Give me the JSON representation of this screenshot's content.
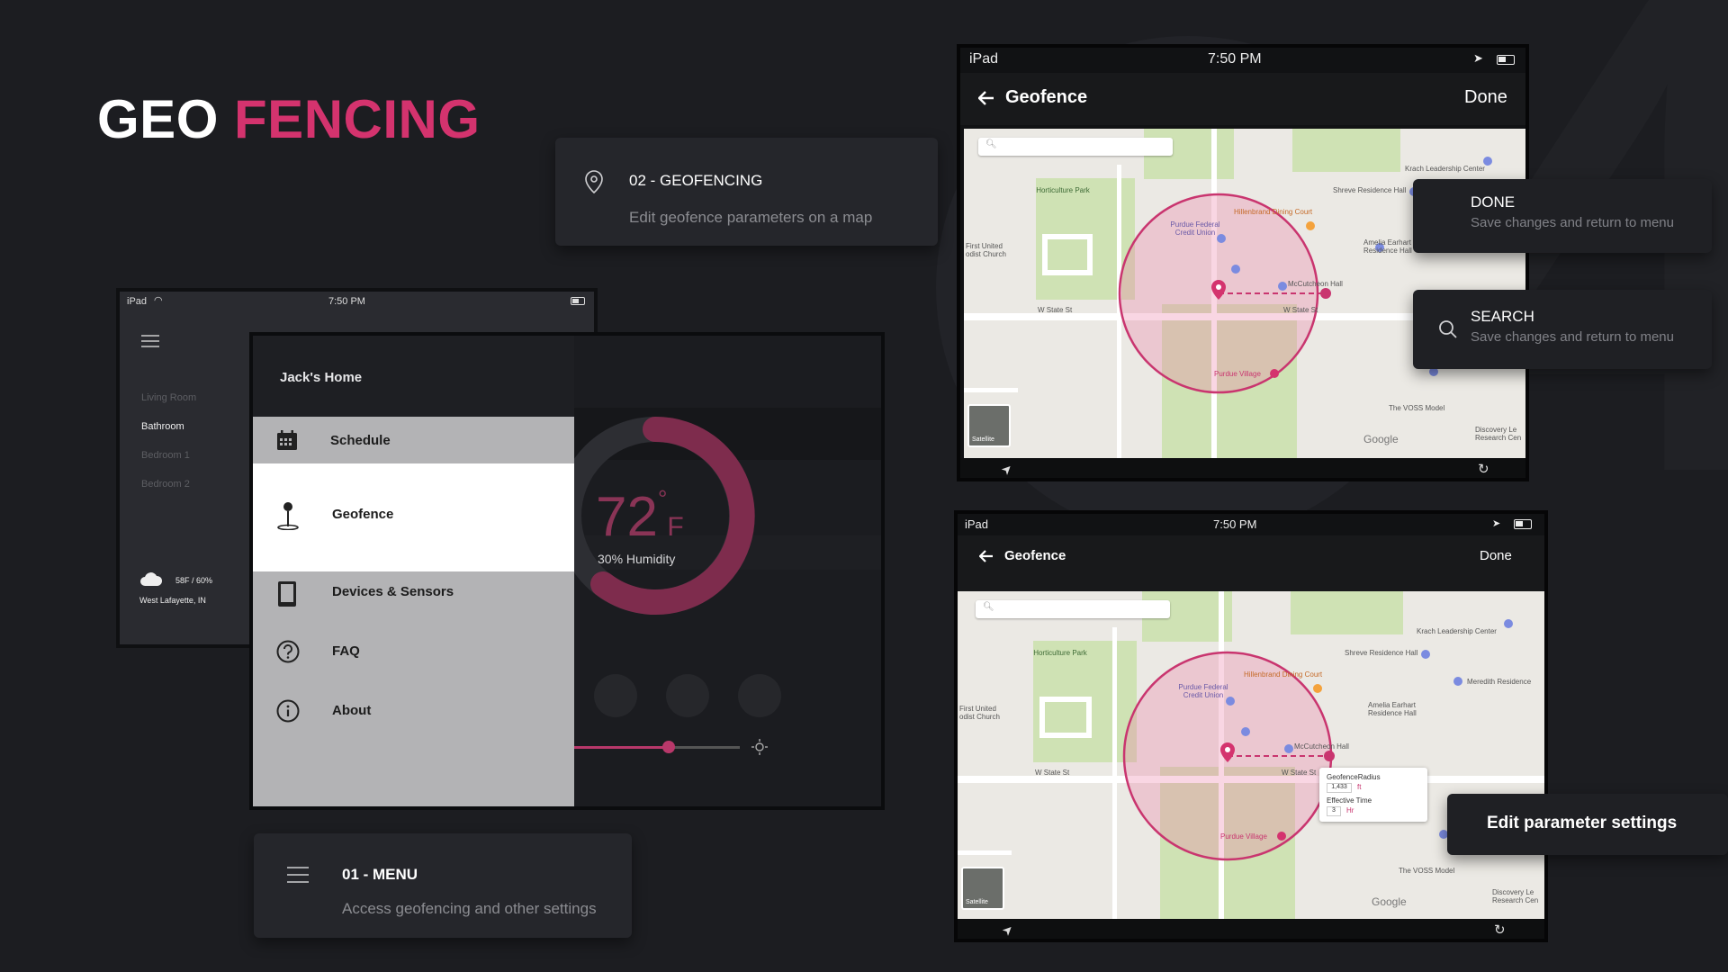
{
  "title": {
    "part1": "GEO",
    "part2": "FENCING"
  },
  "accent": "#d4336e",
  "card_geofencing": {
    "head": "02 - GEOFENCING",
    "sub": "Edit geofence parameters on a map",
    "icon": "map-pin-icon"
  },
  "card_menu": {
    "head": "01 - MENU",
    "sub": "Access geofencing and other settings",
    "icon": "hamburger-icon"
  },
  "card_done": {
    "head": "DONE",
    "sub": "Save changes and return to menu"
  },
  "card_search": {
    "head": "SEARCH",
    "sub": "Save changes and return to menu",
    "icon": "search-icon"
  },
  "card_edit": {
    "label": "Edit parameter settings"
  },
  "left_tablet": {
    "status": {
      "device": "iPad",
      "time": "7:50 PM"
    },
    "rooms": [
      "Living Room",
      "Bathroom",
      "Bedroom 1",
      "Bedroom 2"
    ],
    "weather": {
      "temp": "58F / 60%",
      "location": "West Lafayette, IN"
    },
    "home_name": "Jack's Home",
    "menu": [
      {
        "label": "Schedule",
        "icon": "calendar-icon"
      },
      {
        "label": "Geofence",
        "icon": "pin-icon"
      },
      {
        "label": "Devices & Sensors",
        "icon": "tablet-icon"
      },
      {
        "label": "FAQ",
        "icon": "question-icon"
      },
      {
        "label": "About",
        "icon": "info-icon"
      }
    ],
    "thermostat": {
      "temp": "72",
      "unit_deg": "°",
      "unit": "F",
      "humidity": "30% Humidity"
    }
  },
  "ipad_top": {
    "status": {
      "device": "iPad",
      "time": "7:50 PM"
    },
    "nav": {
      "title": "Geofence",
      "done": "Done"
    }
  },
  "ipad_bottom": {
    "status": {
      "device": "iPad",
      "time": "7:50 PM"
    },
    "nav": {
      "title": "Geofence",
      "done": "Done"
    },
    "popup": {
      "radius_label": "GeofenceRadius",
      "radius_value": "1,433",
      "radius_unit": "ft",
      "time_label": "Effective Time",
      "time_value": "3",
      "time_unit": "Hr"
    }
  },
  "map_labels": {
    "horticulture": "Horticulture Park",
    "church": "First United odist Church",
    "state_st": "W State St",
    "krach": "Krach Leadership Center",
    "shreve": "Shreve Residence Hall",
    "hillenbrand": "Hillenbrand Dining Court",
    "credit_union": "Purdue Federal Credit Union",
    "earhart": "Amelia Earhart Residence Hall",
    "mccutcheon": "McCutcheon Hall",
    "village": "Purdue Village",
    "voss": "The VOSS Model",
    "discovery": "Discovery Le Research Cen",
    "meredith": "Meredith Residence",
    "google": "Google",
    "satellite": "Satellite"
  }
}
